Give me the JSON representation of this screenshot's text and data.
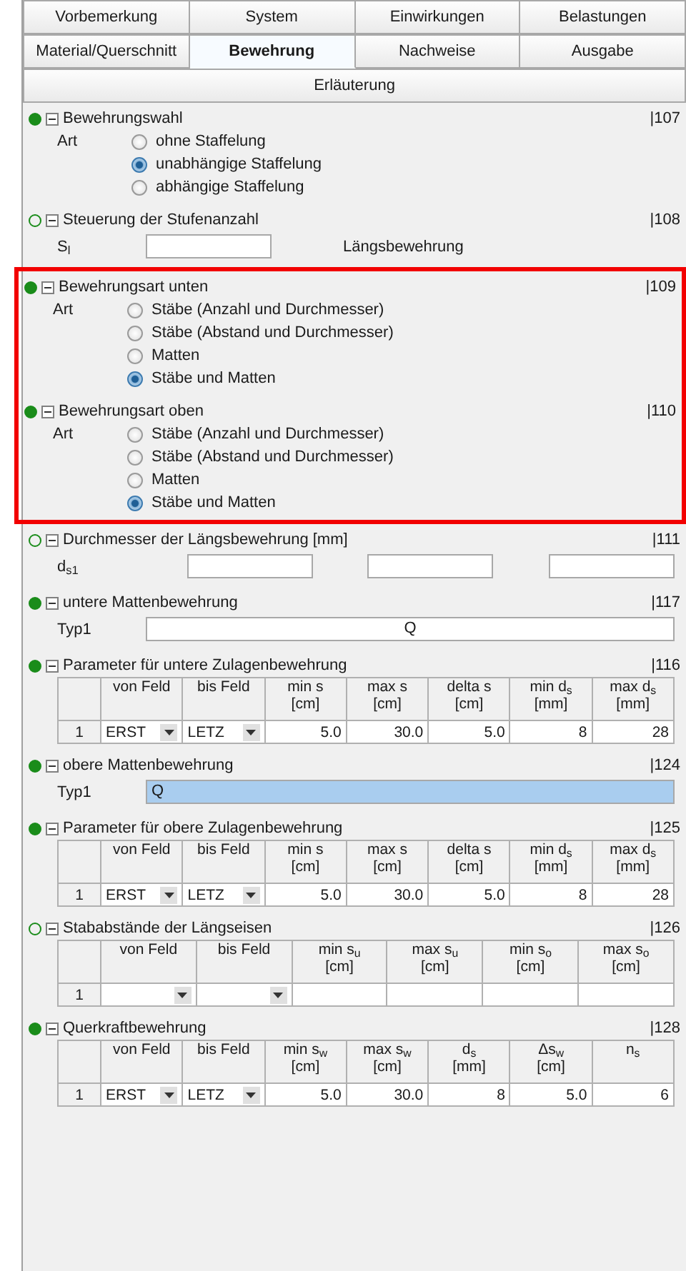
{
  "tab_rows": [
    {
      "tabs": [
        {
          "label": "Vorbemerkung",
          "selected": false
        },
        {
          "label": "System",
          "selected": false
        },
        {
          "label": "Einwirkungen",
          "selected": false
        },
        {
          "label": "Belastungen",
          "selected": false
        }
      ]
    },
    {
      "tabs": [
        {
          "label": "Material/Querschnitt",
          "selected": false
        },
        {
          "label": "Bewehrung",
          "selected": true
        },
        {
          "label": "Nachweise",
          "selected": false
        },
        {
          "label": "Ausgabe",
          "selected": false
        }
      ]
    },
    {
      "tabs": [
        {
          "label": "Erläuterung",
          "selected": false
        }
      ]
    }
  ],
  "sections": [
    {
      "kind": "radio",
      "title": "Bewehrungswahl",
      "number": "|107",
      "complete": true,
      "expanded": true,
      "highlighted": false,
      "label": "Art",
      "options": [
        {
          "label": "ohne Staffelung",
          "selected": false
        },
        {
          "label": "unabhängige Staffelung",
          "selected": true
        },
        {
          "label": "abhängige Staffelung",
          "selected": false
        }
      ]
    },
    {
      "kind": "fields",
      "title": "Steuerung der Stufenanzahl",
      "number": "|108",
      "complete": false,
      "expanded": true,
      "highlighted": false,
      "label": "S$_{l}$",
      "fields": [
        {
          "kind": "text"
        }
      ],
      "note": "Längsbewehrung"
    },
    {
      "kind": "radio",
      "title": "Bewehrungsart unten",
      "number": "|109",
      "complete": true,
      "expanded": true,
      "highlighted": true,
      "label": "Art",
      "options": [
        {
          "label": "Stäbe (Anzahl und Durchmesser)",
          "selected": false
        },
        {
          "label": "Stäbe (Abstand und Durchmesser)",
          "selected": false
        },
        {
          "label": "Matten",
          "selected": false
        },
        {
          "label": "Stäbe und Matten",
          "selected": true
        }
      ]
    },
    {
      "kind": "radio",
      "title": "Bewehrungsart oben",
      "number": "|110",
      "complete": true,
      "expanded": true,
      "highlighted": true,
      "label": "Art",
      "options": [
        {
          "label": "Stäbe (Anzahl und Durchmesser)",
          "selected": false
        },
        {
          "label": "Stäbe (Abstand und Durchmesser)",
          "selected": false
        },
        {
          "label": "Matten",
          "selected": false
        },
        {
          "label": "Stäbe und Matten",
          "selected": true
        }
      ]
    },
    {
      "kind": "fields",
      "title": "Durchmesser der Längsbewehrung [mm]",
      "number": "|111",
      "complete": false,
      "expanded": true,
      "highlighted": false,
      "label": "d$_{s1}$",
      "fields": [
        {
          "kind": "text"
        },
        {
          "kind": "text"
        },
        {
          "kind": "text"
        }
      ]
    },
    {
      "kind": "value",
      "title": "untere Mattenbewehrung",
      "number": "|117",
      "complete": true,
      "expanded": true,
      "highlighted": false,
      "label": "Typ1",
      "value": "Q",
      "selected": false
    },
    {
      "kind": "table",
      "title": "Parameter für untere Zulagenbewehrung",
      "number": "|116",
      "complete": true,
      "expanded": true,
      "highlighted": false,
      "columns": [
        {
          "label": "von Feld",
          "kind": "dropdown"
        },
        {
          "label": "bis Feld",
          "kind": "dropdown"
        },
        {
          "label": "min s\n[cm]",
          "kind": "number"
        },
        {
          "label": "max s\n[cm]",
          "kind": "number"
        },
        {
          "label": "delta s\n[cm]",
          "kind": "number"
        },
        {
          "label": "min d$_{s}$\n[mm]",
          "kind": "number"
        },
        {
          "label": "max d$_{s}$\n[mm]",
          "kind": "number"
        }
      ],
      "rows": [
        {
          "number": "1",
          "cells": [
            "ERST",
            "LETZ",
            "5.0",
            "30.0",
            "5.0",
            "8",
            "28"
          ]
        }
      ]
    },
    {
      "kind": "value",
      "title": "obere Mattenbewehrung",
      "number": "|124",
      "complete": true,
      "expanded": true,
      "highlighted": false,
      "label": "Typ1",
      "value": "Q",
      "selected": true
    },
    {
      "kind": "table",
      "title": "Parameter für obere Zulagenbewehrung",
      "number": "|125",
      "complete": true,
      "expanded": true,
      "highlighted": false,
      "columns": [
        {
          "label": "von Feld",
          "kind": "dropdown"
        },
        {
          "label": "bis Feld",
          "kind": "dropdown"
        },
        {
          "label": "min s\n[cm]",
          "kind": "number"
        },
        {
          "label": "max s\n[cm]",
          "kind": "number"
        },
        {
          "label": "delta s\n[cm]",
          "kind": "number"
        },
        {
          "label": "min d$_{s}$\n[mm]",
          "kind": "number"
        },
        {
          "label": "max d$_{s}$\n[mm]",
          "kind": "number"
        }
      ],
      "rows": [
        {
          "number": "1",
          "cells": [
            "ERST",
            "LETZ",
            "5.0",
            "30.0",
            "5.0",
            "8",
            "28"
          ]
        }
      ]
    },
    {
      "kind": "table",
      "title": "Stababstände der Längseisen",
      "number": "|126",
      "complete": false,
      "expanded": true,
      "highlighted": false,
      "columns": [
        {
          "label": "von Feld",
          "kind": "dropdown"
        },
        {
          "label": "bis Feld",
          "kind": "dropdown"
        },
        {
          "label": "min s$_{u}$\n[cm]",
          "kind": "number"
        },
        {
          "label": "max s$_{u}$\n[cm]",
          "kind": "number"
        },
        {
          "label": "min s$_{o}$\n[cm]",
          "kind": "number"
        },
        {
          "label": "max s$_{o}$\n[cm]",
          "kind": "number"
        }
      ],
      "rows": [
        {
          "number": "1"
        }
      ]
    },
    {
      "kind": "table",
      "title": "Querkraftbewehrung",
      "number": "|128",
      "complete": true,
      "expanded": true,
      "highlighted": false,
      "columns": [
        {
          "label": "von Feld",
          "kind": "dropdown"
        },
        {
          "label": "bis Feld",
          "kind": "dropdown"
        },
        {
          "label": "min s$_{w}$\n[cm]",
          "kind": "number"
        },
        {
          "label": "max s$_{w}$\n[cm]",
          "kind": "number"
        },
        {
          "label": "d$_{s}$\n[mm]",
          "kind": "number"
        },
        {
          "label": "Δs$_{w}$\n[cm]",
          "kind": "number"
        },
        {
          "label": "n$_{s}$",
          "kind": "number"
        }
      ],
      "rows": [
        {
          "number": "1",
          "cells": [
            "ERST",
            "LETZ",
            "5.0",
            "30.0",
            "8",
            "5.0",
            "6"
          ]
        }
      ]
    }
  ]
}
